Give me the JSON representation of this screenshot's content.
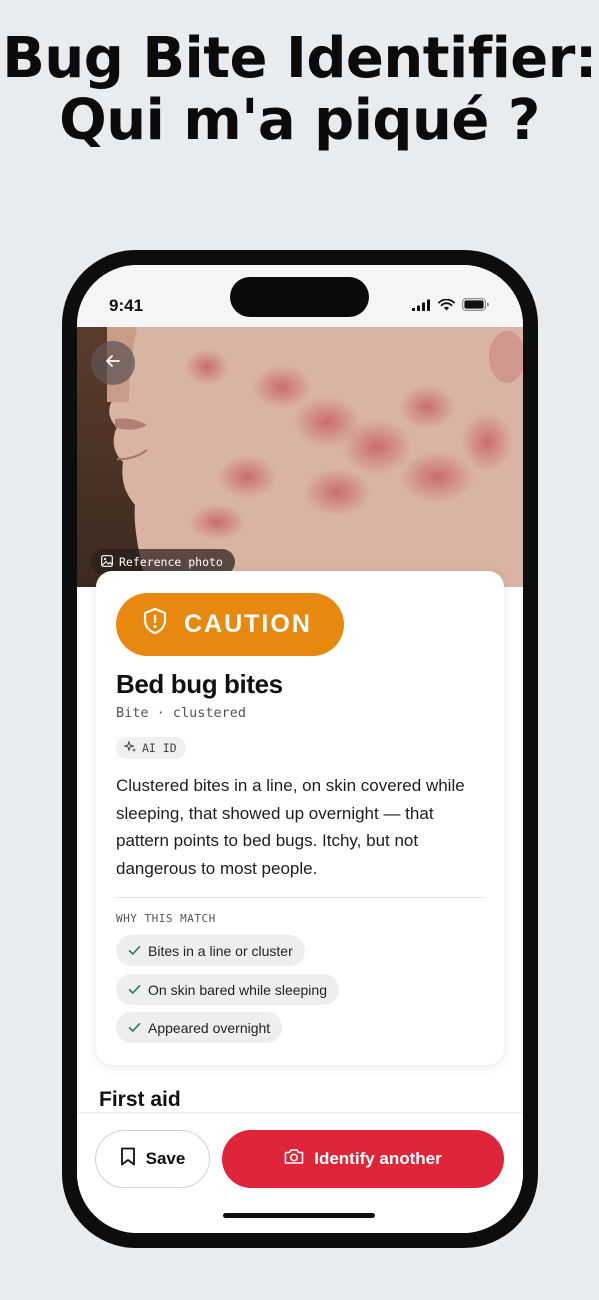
{
  "headline": {
    "line1": "Bug Bite Identifier:",
    "line2": "Qui m'a piqué ?"
  },
  "status_bar": {
    "time": "9:41"
  },
  "photo": {
    "badge_label": "Reference photo"
  },
  "result_card": {
    "severity_label": "CAUTION",
    "severity_color": "#e8880f",
    "title": "Bed bug bites",
    "subtitle": "Bite · clustered",
    "ai_chip_label": "AI ID",
    "description": "Clustered bites in a line, on skin covered while sleeping, that showed up overnight — that pattern points to bed bugs. Itchy, but not dangerous to most people.",
    "why_label": "WHY THIS MATCH",
    "reasons": [
      "Bites in a line or cluster",
      "On skin bared while sleeping",
      "Appeared overnight"
    ]
  },
  "section_heading": "First aid",
  "actions": {
    "save_label": "Save",
    "identify_label": "Identify another",
    "primary_color": "#e0243a"
  }
}
